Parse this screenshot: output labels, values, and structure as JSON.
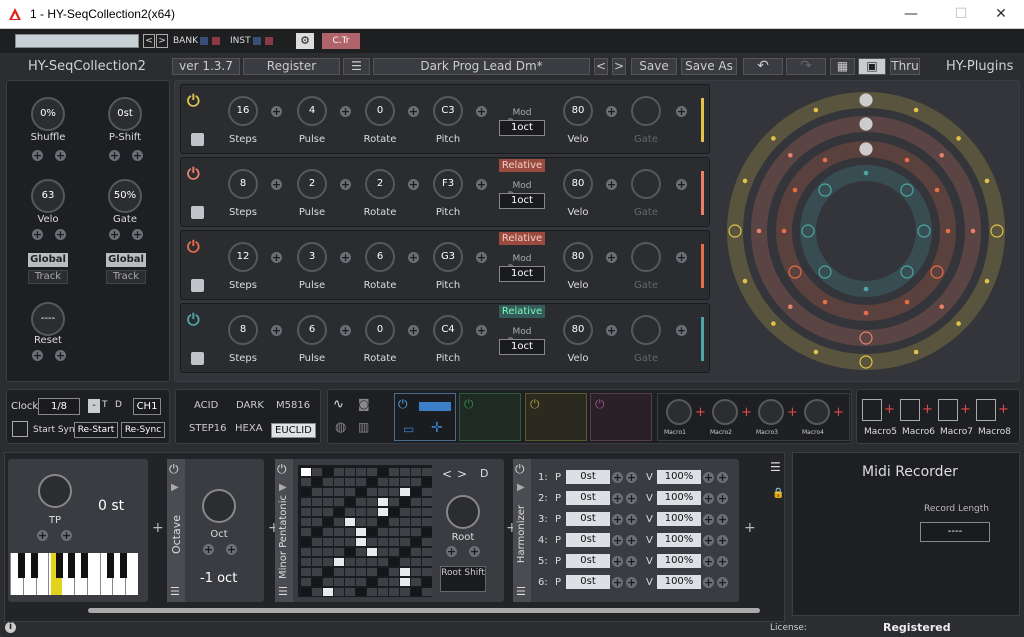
{
  "window": {
    "title": "1 - HY-SeqCollection2(x64)",
    "min": "—",
    "max": "☐",
    "close": "✕"
  },
  "host": {
    "bank": "BANK",
    "inst": "INST",
    "ctr": "C.Tr",
    "gear": "⚙",
    "prev": "<",
    "next": ">"
  },
  "plugin": {
    "name": "HY-SeqCollection2",
    "brand": "HY-Plugins",
    "version": "ver 1.3.7",
    "register": "Register",
    "menu": "☰",
    "preset": "Dark Prog Lead  Dm*",
    "save": "Save",
    "save_as": "Save As",
    "thru": "Thru",
    "prev": "<",
    "next": ">"
  },
  "global": {
    "shuffle": "0%",
    "shuffle_label": "Shuffle",
    "pshift": "0st",
    "pshift_label": "P-Shift",
    "velo": "63",
    "velo_label": "Velo",
    "gate": "50%",
    "gate_label": "Gate",
    "global": "Global",
    "track": "Track",
    "reset": "----",
    "reset_label": "Reset"
  },
  "tracks": [
    {
      "color": "#e2c34a",
      "steps": "16",
      "pulse": "4",
      "rotate": "0",
      "pitch": "C3",
      "mod": "",
      "oct": "1oct",
      "velo": "80"
    },
    {
      "color": "#e8806a",
      "steps": "8",
      "pulse": "2",
      "rotate": "2",
      "pitch": "F3",
      "mod": "Relative",
      "oct": "1oct",
      "velo": "80"
    },
    {
      "color": "#e86e48",
      "steps": "12",
      "pulse": "3",
      "rotate": "6",
      "pitch": "G3",
      "mod": "Relative",
      "oct": "1oct",
      "velo": "80"
    },
    {
      "color": "#4fa6a6",
      "steps": "8",
      "pulse": "6",
      "rotate": "0",
      "pitch": "C4",
      "mod": "Relative",
      "oct": "1oct",
      "velo": "80"
    }
  ],
  "labels": {
    "steps": "Steps",
    "pulse": "Pulse",
    "rotate": "Rotate",
    "pitch": "Pitch",
    "mod_range": "Mod Range",
    "velo": "Velo",
    "gate": "Gate"
  },
  "clock": {
    "label": "Clock",
    "value": "1/8",
    "dash": "-",
    "t": "T",
    "d": "D",
    "ch": "CH1",
    "start_sync": "Start Sync",
    "restart": "Re-Start",
    "resync": "Re-Sync"
  },
  "modes": [
    "ACID",
    "DARK",
    "M5816",
    "STEP16",
    "HEXA",
    "EUCLID"
  ],
  "macros": [
    "Macro1",
    "Macro2",
    "Macro3",
    "Macro4",
    "Macro5",
    "Macro6",
    "Macro7",
    "Macro8"
  ],
  "fx": {
    "tp": "0 st",
    "tp_label": "TP",
    "octave": "Octave",
    "oct": "Oct",
    "oct_value": "-1 oct",
    "scale": "Minor Pentatonic",
    "root": "Root",
    "root_shift": "Root Shift",
    "d": "D",
    "harmonizer": "Harmonizer"
  },
  "harm": [
    {
      "n": "1:",
      "p": "P",
      "st": "0st",
      "v": "V",
      "pct": "100%"
    },
    {
      "n": "2:",
      "p": "P",
      "st": "0st",
      "v": "V",
      "pct": "100%"
    },
    {
      "n": "3:",
      "p": "P",
      "st": "0st",
      "v": "V",
      "pct": "100%"
    },
    {
      "n": "4:",
      "p": "P",
      "st": "0st",
      "v": "V",
      "pct": "100%"
    },
    {
      "n": "5:",
      "p": "P",
      "st": "0st",
      "v": "V",
      "pct": "100%"
    },
    {
      "n": "6:",
      "p": "P",
      "st": "0st",
      "v": "V",
      "pct": "100%"
    }
  ],
  "recorder": {
    "title": "Midi Recorder",
    "len_label": "Record Length",
    "len": "----"
  },
  "footer": {
    "license": "License:",
    "status": "Registered",
    "info": "i"
  }
}
